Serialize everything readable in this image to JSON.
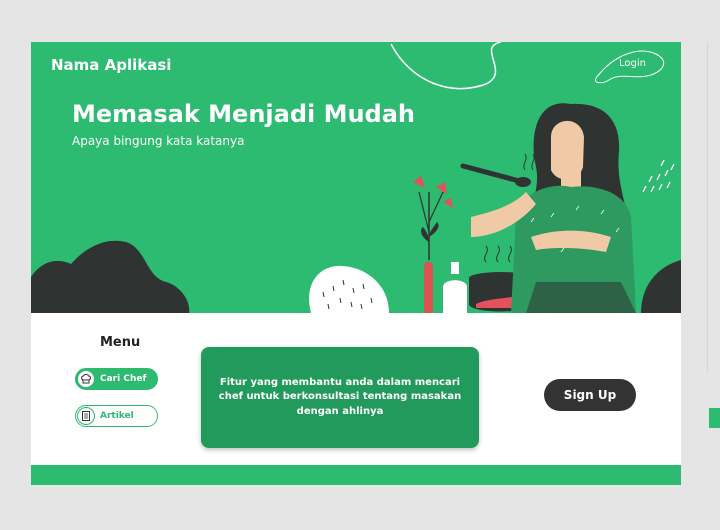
{
  "header": {
    "app_name": "Nama Aplikasi",
    "login_label": "Login"
  },
  "hero": {
    "title": "Memasak Menjadi Mudah",
    "subtitle": "Apaya bingung kata katanya"
  },
  "menu": {
    "title": "Menu",
    "items": [
      {
        "label": "Cari Chef",
        "icon": "chef-hat-icon",
        "active": true
      },
      {
        "label": "Artikel",
        "icon": "article-icon",
        "active": false
      }
    ]
  },
  "info_card": {
    "text": "Fitur yang membantu anda dalam mencari chef untuk berkonsultasi tentang masakan dengan ahlinya"
  },
  "signup_label": "Sign Up",
  "colors": {
    "accent": "#2dba71",
    "card": "#229a5c",
    "button_dark": "#333333"
  }
}
